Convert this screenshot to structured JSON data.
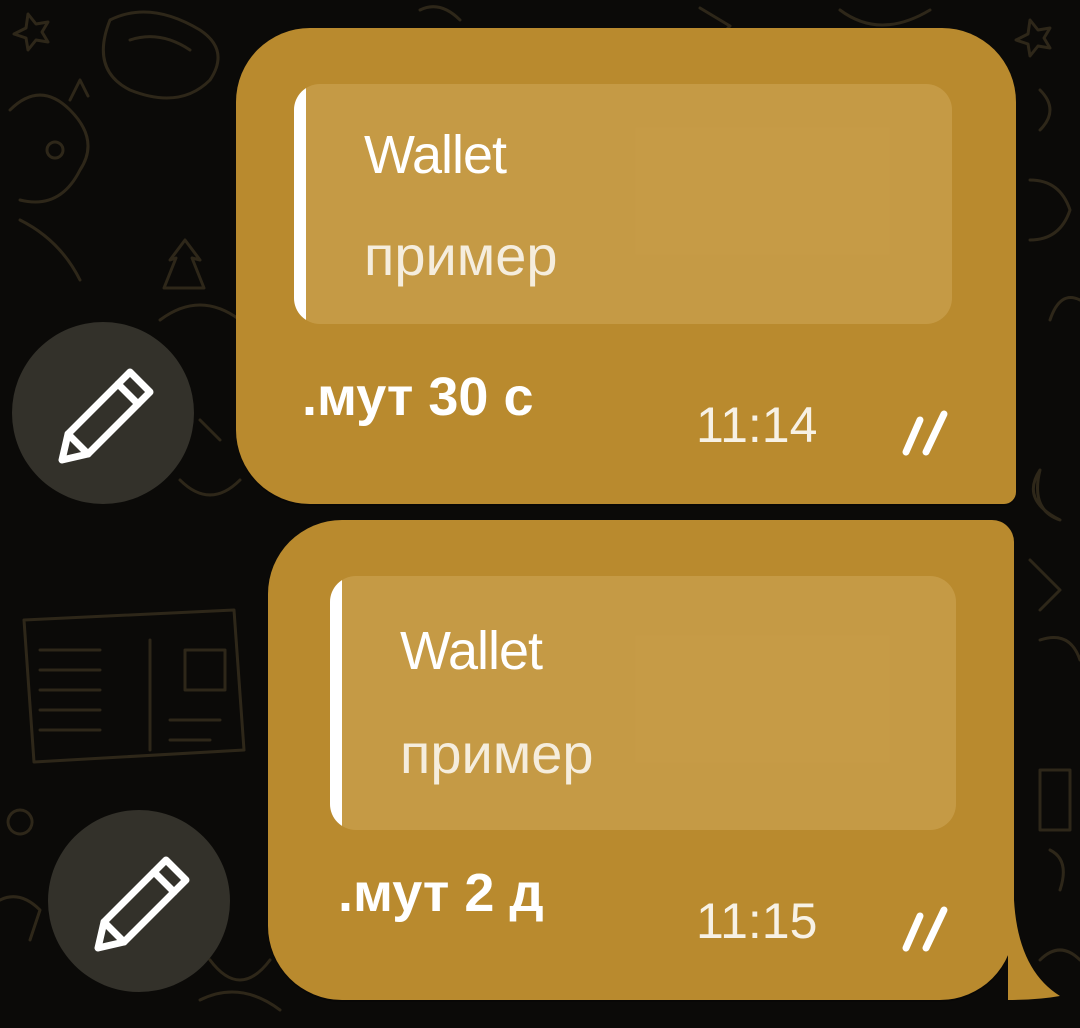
{
  "messages": [
    {
      "reply_name": "Wallet",
      "reply_text": "пример",
      "text": ".мут 30 с",
      "time": "11:14",
      "status_icon": "double-check-icon"
    },
    {
      "reply_name": "Wallet",
      "reply_text": "пример",
      "text": ".мут 2 д",
      "time": "11:15",
      "status_icon": "double-check-icon"
    }
  ],
  "actions": {
    "edit_icon": "pencil-icon"
  },
  "colors": {
    "background": "#0b0a08",
    "bubble": "#b98a2e",
    "reply_bar": "#ffffff",
    "edit_button": "#33312a"
  }
}
